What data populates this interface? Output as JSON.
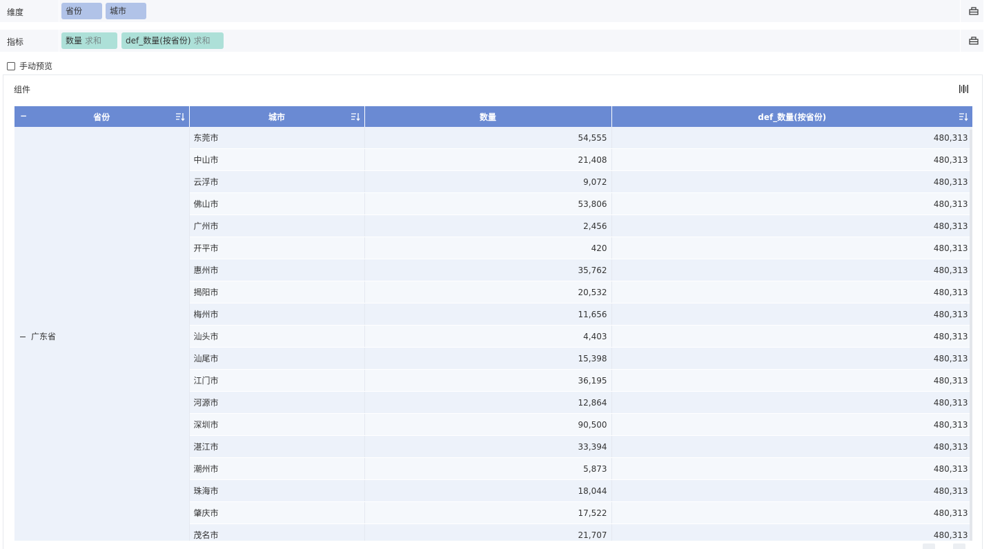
{
  "dimensions": {
    "label": "维度",
    "chips": [
      "省份",
      "城市"
    ]
  },
  "metrics": {
    "label": "指标",
    "chips": [
      {
        "name": "数量",
        "agg": "求和"
      },
      {
        "name": "def_数量(按省份)",
        "agg": "求和"
      }
    ]
  },
  "preview": {
    "label": "手动预览",
    "checked": false
  },
  "panel": {
    "title": "组件"
  },
  "table": {
    "headers": [
      "省份",
      "城市",
      "数量",
      "def_数量(按省份)"
    ],
    "province": "广东省",
    "rows": [
      {
        "city": "东莞市",
        "qty": "54,555",
        "def": "480,313"
      },
      {
        "city": "中山市",
        "qty": "21,408",
        "def": "480,313"
      },
      {
        "city": "云浮市",
        "qty": "9,072",
        "def": "480,313"
      },
      {
        "city": "佛山市",
        "qty": "53,806",
        "def": "480,313"
      },
      {
        "city": "广州市",
        "qty": "2,456",
        "def": "480,313"
      },
      {
        "city": "开平市",
        "qty": "420",
        "def": "480,313"
      },
      {
        "city": "惠州市",
        "qty": "35,762",
        "def": "480,313"
      },
      {
        "city": "揭阳市",
        "qty": "20,532",
        "def": "480,313"
      },
      {
        "city": "梅州市",
        "qty": "11,656",
        "def": "480,313"
      },
      {
        "city": "汕头市",
        "qty": "4,403",
        "def": "480,313"
      },
      {
        "city": "汕尾市",
        "qty": "15,398",
        "def": "480,313"
      },
      {
        "city": "江门市",
        "qty": "36,195",
        "def": "480,313"
      },
      {
        "city": "河源市",
        "qty": "12,864",
        "def": "480,313"
      },
      {
        "city": "深圳市",
        "qty": "90,500",
        "def": "480,313"
      },
      {
        "city": "湛江市",
        "qty": "33,394",
        "def": "480,313"
      },
      {
        "city": "潮州市",
        "qty": "5,873",
        "def": "480,313"
      },
      {
        "city": "珠海市",
        "qty": "18,044",
        "def": "480,313"
      },
      {
        "city": "肇庆市",
        "qty": "17,522",
        "def": "480,313"
      },
      {
        "city": "茂名市",
        "qty": "21,707",
        "def": "480,313"
      }
    ]
  },
  "colors": {
    "header_bg": "#6a8ad3",
    "dim_chip": "#b1c3e8",
    "metric_chip": "#ade0d8"
  },
  "icons": {
    "row_setting": "settings-box-icon",
    "sort": "sort-icon",
    "panel": "barcode-icon"
  }
}
